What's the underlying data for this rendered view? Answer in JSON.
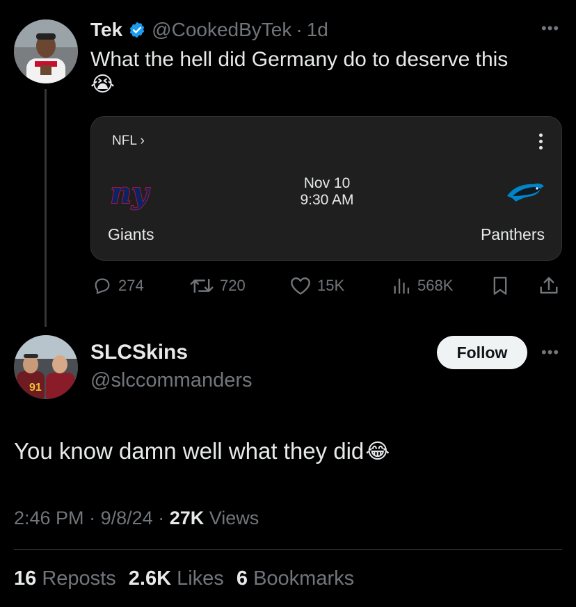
{
  "parent_tweet": {
    "display_name": "Tek",
    "handle": "@CookedByTek",
    "separator": "·",
    "time": "1d",
    "more": "•••",
    "text": "What the hell did Germany do to deserve this",
    "emoji": "😭",
    "card": {
      "league": "NFL ›",
      "date": "Nov 10",
      "time": "9:30 AM",
      "home_team": "Giants",
      "home_logo_text": "ny",
      "away_team": "Panthers"
    },
    "actions": {
      "replies": "274",
      "reposts": "720",
      "likes": "15K",
      "views": "568K"
    }
  },
  "reply_tweet": {
    "display_name": "SLCSkins",
    "handle": "@slccommanders",
    "follow_label": "Follow",
    "more": "•••",
    "text": "You know damn well what they did",
    "emoji": "😂",
    "meta": {
      "time": "2:46 PM",
      "sep1": "·",
      "date": "9/8/24",
      "sep2": "·",
      "views_count": "27K",
      "views_label": "Views"
    },
    "stats": {
      "reposts_count": "16",
      "reposts_label": "Reposts",
      "likes_count": "2.6K",
      "likes_label": "Likes",
      "bookmarks_count": "6",
      "bookmarks_label": "Bookmarks"
    }
  },
  "colors": {
    "background": "#000000",
    "text_primary": "#e7e9ea",
    "text_muted": "#71767b",
    "verified_blue": "#1d9bf0",
    "giants_blue": "#0b2265",
    "giants_red": "#a71930",
    "panthers_blue": "#0085ca"
  }
}
